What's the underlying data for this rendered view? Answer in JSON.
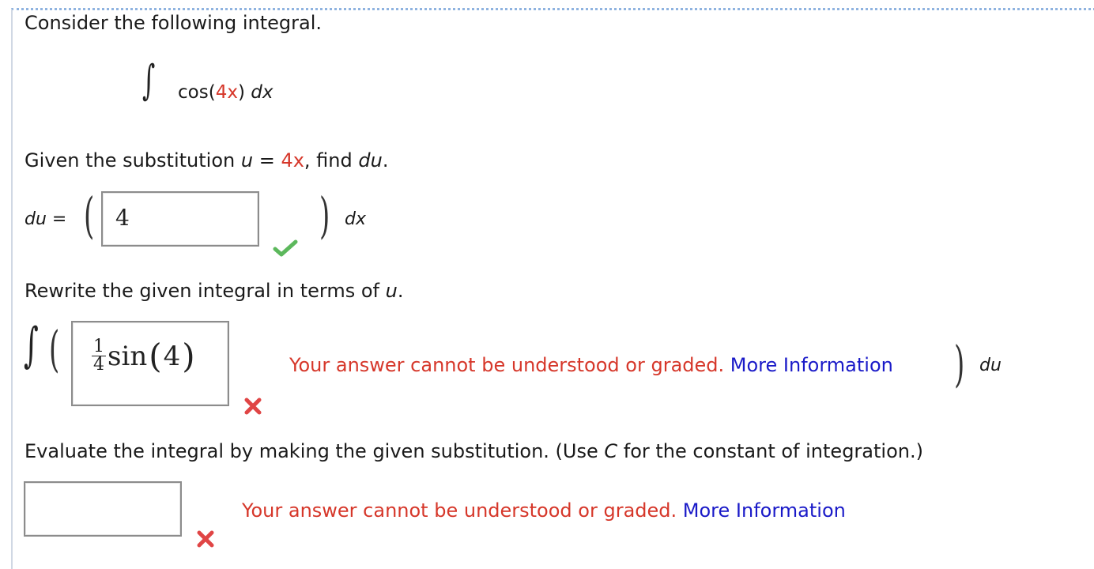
{
  "intro": {
    "text": "Consider the following integral."
  },
  "integral": {
    "symbol": "∫",
    "func": "cos(",
    "arg": "4x",
    "close": ")",
    "dx": "dx"
  },
  "part1": {
    "prompt_prefix": "Given the substitution ",
    "u_var": "u",
    "equals": " = ",
    "u_expr": "4x",
    "prompt_mid": ", find ",
    "target": "du",
    "prompt_end": ".",
    "lhs": "du",
    "lhs_eq": "=",
    "answer_value": "4",
    "dx_label": "dx",
    "status": "correct"
  },
  "part2": {
    "prompt_prefix": "Rewrite the given integral in terms of ",
    "u_var": "u",
    "prompt_end": ".",
    "answer": {
      "frac_num": "1",
      "frac_den": "4",
      "func": "sin",
      "open": "(",
      "arg": "4",
      "close": ")"
    },
    "feedback_text": "Your answer cannot be understood or graded.",
    "more_info": "More Information",
    "du_label": "du",
    "status": "incorrect"
  },
  "part3": {
    "prompt_prefix": "Evaluate the integral by making the given substitution. (Use ",
    "const_var": "C",
    "prompt_end": " for the constant of integration.)",
    "answer_value": "",
    "feedback_text": "Your answer cannot be understood or graded.",
    "more_info": "More Information",
    "status": "incorrect"
  },
  "colors": {
    "highlight_red": "#d6372a",
    "link_blue": "#1a1ac8",
    "correct_green": "#5cb85c",
    "incorrect_red": "#e04545"
  },
  "icons": {
    "correct": "checkmark-icon",
    "incorrect": "x-mark-icon"
  }
}
